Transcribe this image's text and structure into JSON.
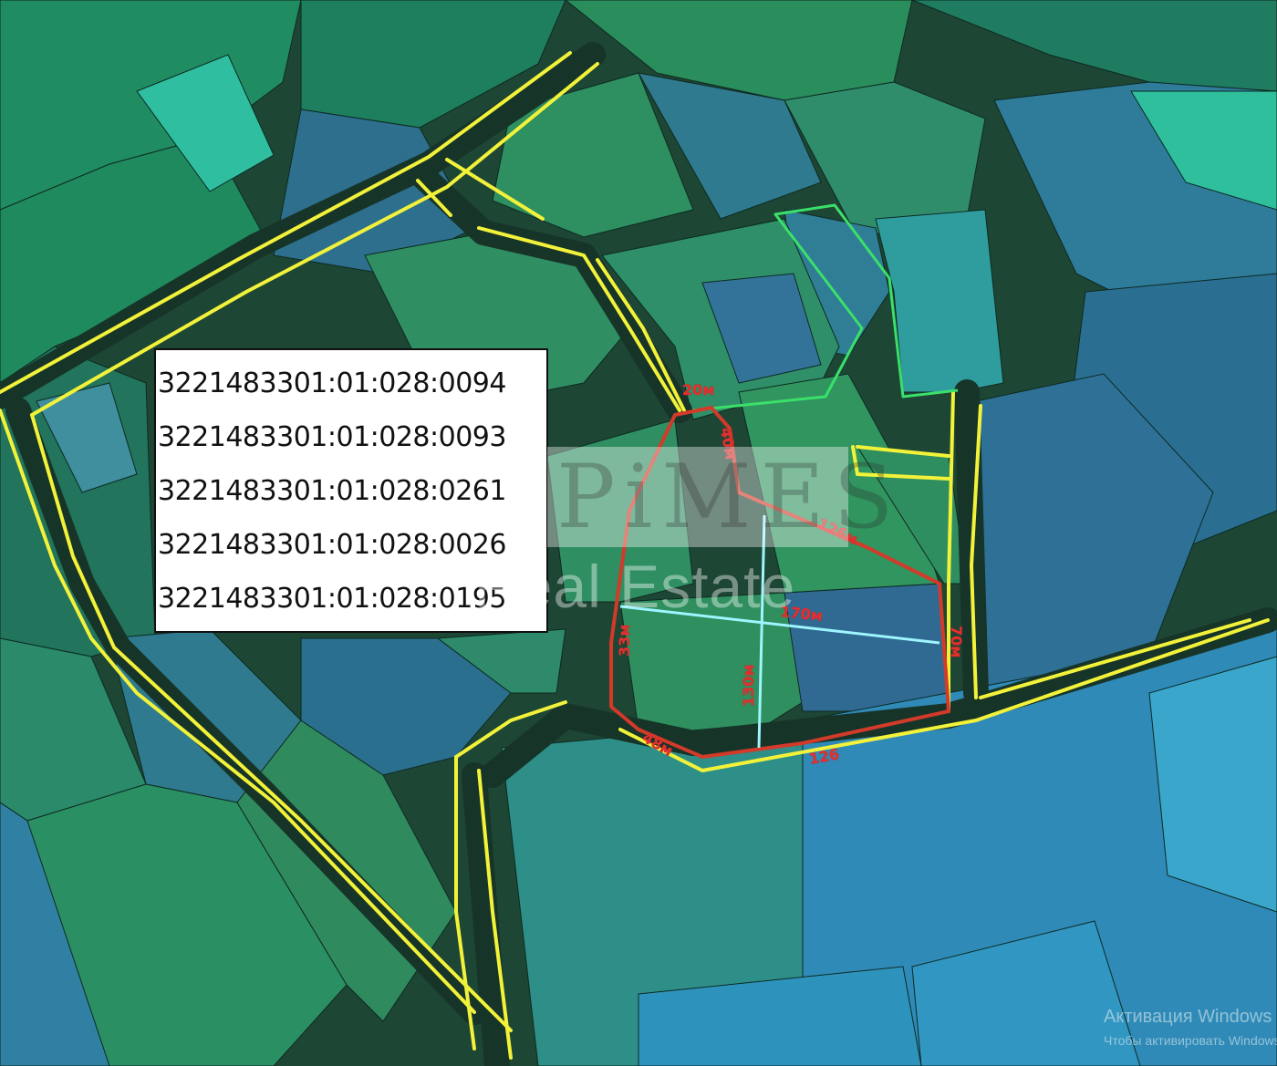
{
  "cadastral_numbers": [
    "3221483301:01:028:0094",
    "3221483301:01:028:0093",
    "3221483301:01:028:0261",
    "3221483301:01:028:0026",
    "3221483301:01:028:0195"
  ],
  "dimensions": {
    "top": "20м",
    "upper_right": "40м",
    "diagonal": "126м",
    "right": "70м",
    "bottom": "126",
    "bottom_left": "48м",
    "left": "33м",
    "center_vertical": "130м",
    "center_horizontal": "170м"
  },
  "watermark": {
    "letters": [
      "P",
      "i",
      "M",
      "E",
      "S"
    ],
    "subtitle": "Real Estate"
  },
  "system_notice": {
    "title": "Активация Windows",
    "subtitle": "Чтобы активировать Windows"
  },
  "colors": {
    "road_line": "#f2f23a",
    "parcel_outline": "#d23a2a",
    "green_outline": "#3be06a",
    "measure_line": "#9ff5ff"
  }
}
